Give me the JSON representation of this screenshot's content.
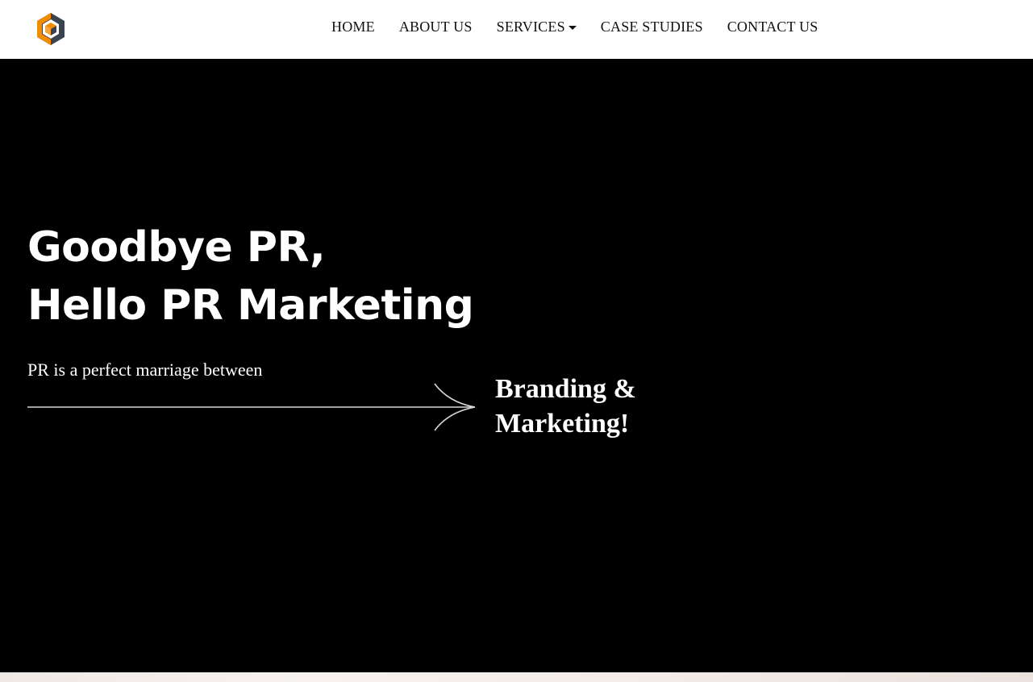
{
  "nav": {
    "logo_icon": "hexagon-logo-icon",
    "colors": {
      "logo_orange": "#f28c00",
      "logo_slate": "#3a4450"
    },
    "items": [
      {
        "label": "HOME"
      },
      {
        "label": "ABOUT US"
      },
      {
        "label": "SERVICES",
        "has_dropdown": true
      },
      {
        "label": "CASE STUDIES"
      },
      {
        "label": "CONTACT US"
      }
    ]
  },
  "hero": {
    "background": "#000000",
    "headline_line1": "Goodbye PR,",
    "headline_line2": "Hello PR Marketing",
    "tagline": "PR is a perfect marriage between",
    "highlight_line1": "Branding &",
    "highlight_line2": "Marketing!",
    "arrow_icon": "arrow-right-icon"
  }
}
